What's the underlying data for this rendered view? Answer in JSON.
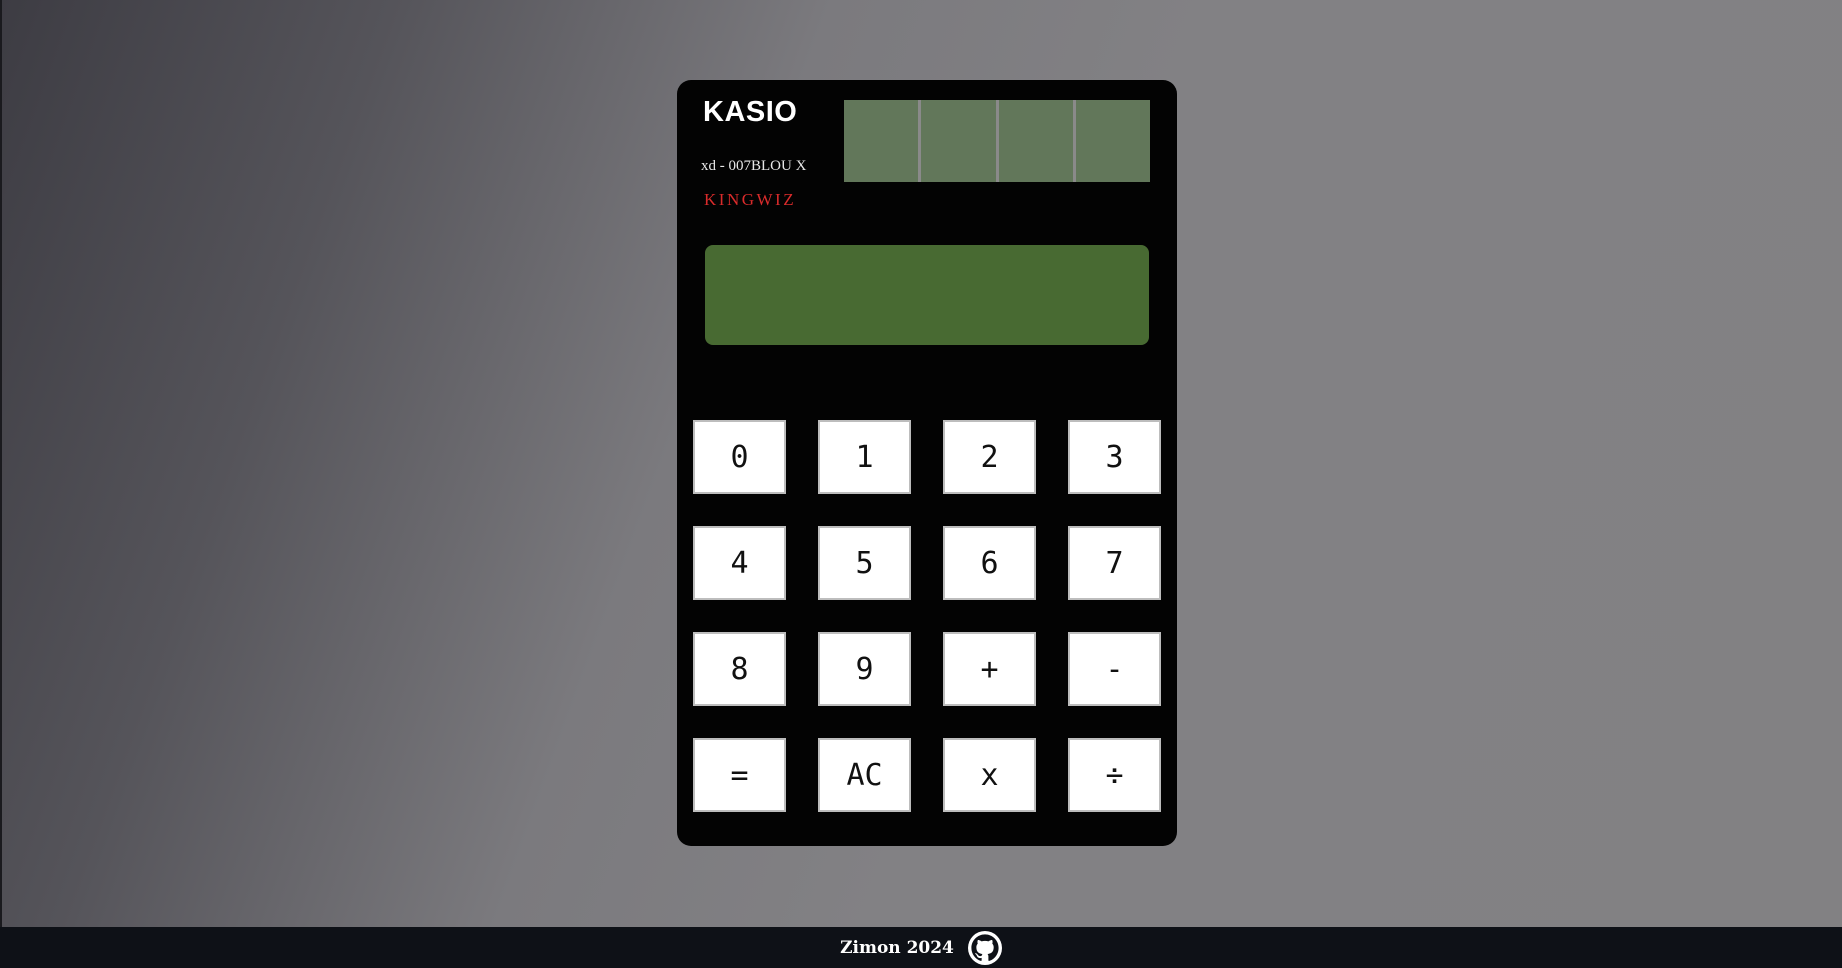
{
  "brand": {
    "name": "KASIO",
    "model": "xd - 007BLOU X",
    "maker": "KINGWIZ"
  },
  "display": {
    "value": ""
  },
  "keypad": {
    "rows": [
      [
        "0",
        "1",
        "2",
        "3"
      ],
      [
        "4",
        "5",
        "6",
        "7"
      ],
      [
        "8",
        "9",
        "+",
        "-"
      ],
      [
        "=",
        "AC",
        "x",
        "÷"
      ]
    ]
  },
  "footer": {
    "text": "Zimon 2024",
    "icon": "github-icon"
  },
  "colors": {
    "calculator_body": "#030303",
    "screen": "#486a32",
    "solar_cell": "#62775a",
    "maker_text": "#d92b2b",
    "footer_bg": "#0e1117"
  }
}
